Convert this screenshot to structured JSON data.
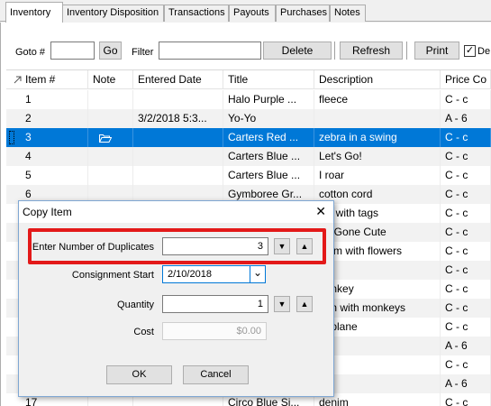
{
  "tabs": [
    "Inventory",
    "Inventory Disposition",
    "Transactions",
    "Payouts",
    "Purchases",
    "Notes"
  ],
  "toolbar": {
    "goto_label": "Goto #",
    "goto_value": "",
    "go_label": "Go",
    "filter_label": "Filter",
    "filter_value": "",
    "delete_label": "Delete",
    "refresh_label": "Refresh",
    "print_label": "Print",
    "checkbox_label": "De",
    "checkbox_mark": "✓"
  },
  "grid": {
    "headers": [
      "Item #",
      "Note",
      "Entered Date",
      "Title",
      "Description",
      "Price Co"
    ],
    "rows": [
      {
        "item": "1",
        "note": "",
        "date": "",
        "title": "Halo Purple ...",
        "desc": "fleece",
        "price": "C - c"
      },
      {
        "item": "2",
        "note": "",
        "date": "3/2/2018 5:3...",
        "title": "Yo-Yo",
        "desc": "",
        "price": "A - 6"
      },
      {
        "item": "3",
        "note": "folder-icon",
        "date": "",
        "title": "Carters Red ...",
        "desc": "zebra in a swing",
        "price": "C - c"
      },
      {
        "item": "4",
        "note": "",
        "date": "",
        "title": "Carters Blue ...",
        "desc": "Let's Go!",
        "price": "C - c"
      },
      {
        "item": "5",
        "note": "",
        "date": "",
        "title": "Carters Blue ...",
        "desc": "I roar",
        "price": "C - c"
      },
      {
        "item": "6",
        "note": "",
        "date": "",
        "title": "Gymboree Gr...",
        "desc": "cotton cord",
        "price": "C - c"
      },
      {
        "item": "",
        "note": "",
        "date": "",
        "title": "",
        "desc": "ew with tags",
        "price": "C - c"
      },
      {
        "item": "",
        "note": "",
        "date": "",
        "title": "",
        "desc": "og Gone Cute",
        "price": "C - c"
      },
      {
        "item": "",
        "note": "",
        "date": "",
        "title": "",
        "desc": "enim with flowers",
        "price": "C - c"
      },
      {
        "item": "",
        "note": "",
        "date": "",
        "title": "",
        "desc": "",
        "price": "C - c"
      },
      {
        "item": "",
        "note": "",
        "date": "",
        "title": "",
        "desc": "nonkey",
        "price": "C - c"
      },
      {
        "item": "",
        "note": "",
        "date": "",
        "title": "",
        "desc": "een with monkeys",
        "price": "C - c"
      },
      {
        "item": "",
        "note": "",
        "date": "",
        "title": "",
        "desc": "airplane",
        "price": "C - c"
      },
      {
        "item": "",
        "note": "",
        "date": "",
        "title": "",
        "desc": "",
        "price": "A - 6"
      },
      {
        "item": "",
        "note": "",
        "date": "",
        "title": "",
        "desc": "",
        "price": "C - c"
      },
      {
        "item": "",
        "note": "",
        "date": "",
        "title": "",
        "desc": "",
        "price": "A - 6"
      },
      {
        "item": "17",
        "note": "",
        "date": "",
        "title": "Circo Blue Si...",
        "desc": "denim",
        "price": "C - c"
      }
    ]
  },
  "dialog": {
    "title": "Copy Item",
    "close_glyph": "✕",
    "duplicates_label": "Enter Number of Duplicates",
    "duplicates_value": "3",
    "consignment_label": "Consignment Start",
    "consignment_value": "2/10/2018",
    "quantity_label": "Quantity",
    "quantity_value": "1",
    "cost_label": "Cost",
    "cost_value": "$0.00",
    "ok_label": "OK",
    "cancel_label": "Cancel",
    "down_glyph": "▼",
    "up_glyph": "▲",
    "dropdown_glyph": "⌄"
  },
  "colors": {
    "selection": "#0078d7",
    "highlight": "#e31919"
  }
}
